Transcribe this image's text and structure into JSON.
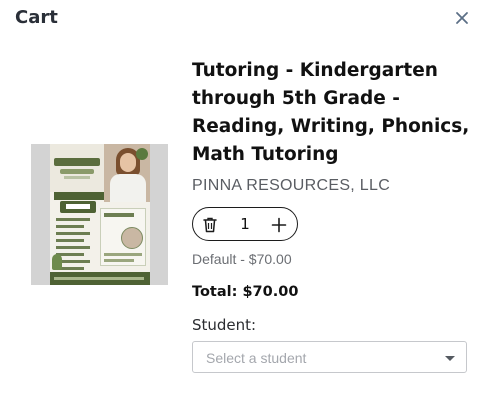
{
  "header": {
    "title": "Cart"
  },
  "item": {
    "title": "Tutoring - Kindergarten through 5th Grade - Reading, Writing, Phonics, Math Tutoring",
    "vendor": "PINNA RESOURCES, LLC",
    "quantity": "1",
    "variant": "Default - $70.00",
    "total": "Total: $70.00"
  },
  "student": {
    "label": "Student:",
    "placeholder": "Select a student"
  },
  "icons": {
    "close": "close-icon",
    "trash": "trash-icon",
    "plus": "plus-icon",
    "caret": "chevron-down-icon"
  },
  "colors": {
    "text": "#111111",
    "muted": "#6b6e73",
    "border": "#c6c8cc",
    "accent": "#4e6234"
  }
}
